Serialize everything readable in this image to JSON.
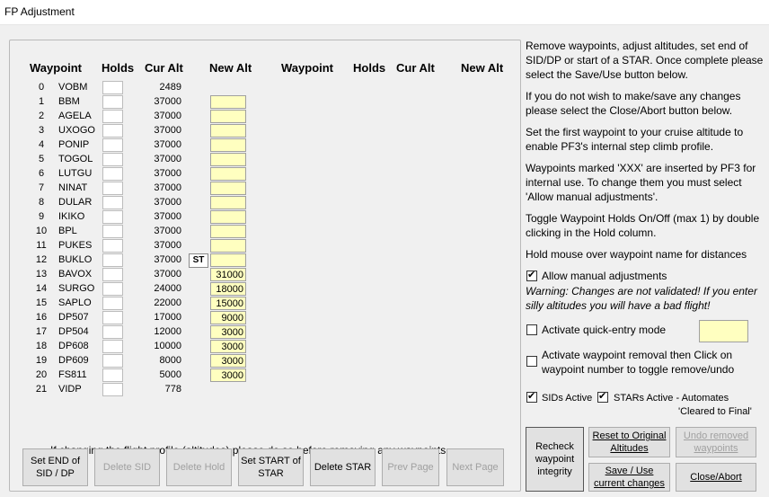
{
  "window": {
    "title": "FP Adjustment"
  },
  "headers": {
    "left": {
      "waypoint": "Waypoint",
      "holds": "Holds",
      "cur_alt": "Cur Alt",
      "new_alt": "New Alt"
    },
    "right": {
      "waypoint": "Waypoint",
      "holds": "Holds",
      "cur_alt": "Cur Alt",
      "new_alt": "New Alt"
    }
  },
  "waypoints": [
    {
      "num": "0",
      "name": "VOBM",
      "cur_alt": "2489",
      "new_alt": null
    },
    {
      "num": "1",
      "name": "BBM",
      "cur_alt": "37000",
      "new_alt": ""
    },
    {
      "num": "2",
      "name": "AGELA",
      "cur_alt": "37000",
      "new_alt": ""
    },
    {
      "num": "3",
      "name": "UXOGO",
      "cur_alt": "37000",
      "new_alt": ""
    },
    {
      "num": "4",
      "name": "PONIP",
      "cur_alt": "37000",
      "new_alt": ""
    },
    {
      "num": "5",
      "name": "TOGOL",
      "cur_alt": "37000",
      "new_alt": ""
    },
    {
      "num": "6",
      "name": "LUTGU",
      "cur_alt": "37000",
      "new_alt": ""
    },
    {
      "num": "7",
      "name": "NINAT",
      "cur_alt": "37000",
      "new_alt": ""
    },
    {
      "num": "8",
      "name": "DULAR",
      "cur_alt": "37000",
      "new_alt": ""
    },
    {
      "num": "9",
      "name": "IKIKO",
      "cur_alt": "37000",
      "new_alt": ""
    },
    {
      "num": "10",
      "name": "BPL",
      "cur_alt": "37000",
      "new_alt": ""
    },
    {
      "num": "11",
      "name": "PUKES",
      "cur_alt": "37000",
      "new_alt": ""
    },
    {
      "num": "12",
      "name": "BUKLO",
      "cur_alt": "37000",
      "new_alt": ""
    },
    {
      "num": "13",
      "name": "BAVOX",
      "cur_alt": "37000",
      "new_alt": "31000"
    },
    {
      "num": "14",
      "name": "SURGO",
      "cur_alt": "24000",
      "new_alt": "18000"
    },
    {
      "num": "15",
      "name": "SAPLO",
      "cur_alt": "22000",
      "new_alt": "15000"
    },
    {
      "num": "16",
      "name": "DP507",
      "cur_alt": "17000",
      "new_alt": "9000"
    },
    {
      "num": "17",
      "name": "DP504",
      "cur_alt": "12000",
      "new_alt": "3000"
    },
    {
      "num": "18",
      "name": "DP608",
      "cur_alt": "10000",
      "new_alt": "3000"
    },
    {
      "num": "19",
      "name": "DP609",
      "cur_alt": "8000",
      "new_alt": "3000"
    },
    {
      "num": "20",
      "name": "FS811",
      "cur_alt": "5000",
      "new_alt": "3000"
    },
    {
      "num": "21",
      "name": "VIDP",
      "cur_alt": "778",
      "new_alt": null
    }
  ],
  "st_tag": "ST",
  "bottom_note": "If changing the flight profile (altitudes) please do so before removing any waypoints",
  "buttons": {
    "set_end_sid": "Set END of SID / DP",
    "delete_sid": "Delete SID",
    "delete_hold": "Delete Hold",
    "set_start_star": "Set START of STAR",
    "delete_star": "Delete STAR",
    "prev_page": "Prev Page",
    "next_page": "Next Page",
    "recheck": "Recheck waypoint integrity",
    "reset": "Reset to Original Altitudes",
    "undo_removed": "Undo removed waypoints",
    "save_use": "Save / Use current changes",
    "close_abort": "Close/Abort"
  },
  "instructions": {
    "p1": "Remove waypoints, adjust altitudes, set end of SID/DP or start of a STAR. Once complete please select the Save/Use button below.",
    "p2": "If you do not wish to make/save any changes please select the Close/Abort button below.",
    "p3": "Set the first waypoint to your cruise altitude to enable PF3's internal step climb profile.",
    "p4": "Waypoints marked 'XXX' are inserted by PF3 for internal use. To change them you must select 'Allow manual adjustments'.",
    "p5": "Toggle Waypoint Holds On/Off (max 1) by double clicking in the Hold column.",
    "p6": "Hold mouse over waypoint name for distances"
  },
  "options": {
    "allow_manual": {
      "label": "Allow manual adjustments",
      "checked": true
    },
    "warning": "Warning: Changes are not validated! If you enter silly altitudes you will have a bad flight!",
    "quick_entry": {
      "label": "Activate quick-entry mode",
      "checked": false
    },
    "waypoint_removal": {
      "label": "Activate waypoint removal then Click on waypoint number to toggle remove/undo",
      "checked": false
    },
    "sids_active": {
      "label": "SIDs Active",
      "checked": true
    },
    "stars_active": {
      "label": "STARs Active - Automates",
      "checked": true
    },
    "cleared_final": "'Cleared to Final'"
  },
  "colors": {
    "input_bg": "#ffffc0",
    "disabled_text": "#a0a0a0",
    "face": "#f0f0f0"
  }
}
